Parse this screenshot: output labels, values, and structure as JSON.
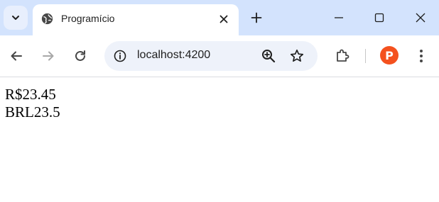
{
  "tab": {
    "title": "Programício",
    "favicon": "globe-icon"
  },
  "toolbar": {
    "url": "localhost:4200",
    "profile_initial": "P"
  },
  "content": {
    "lines": [
      "R$23.45",
      "BRL23.5"
    ]
  },
  "colors": {
    "tabstrip": "#d3e3fd",
    "omnibox": "#eef2fa",
    "avatar": "#f4511e",
    "icon": "#474747"
  }
}
